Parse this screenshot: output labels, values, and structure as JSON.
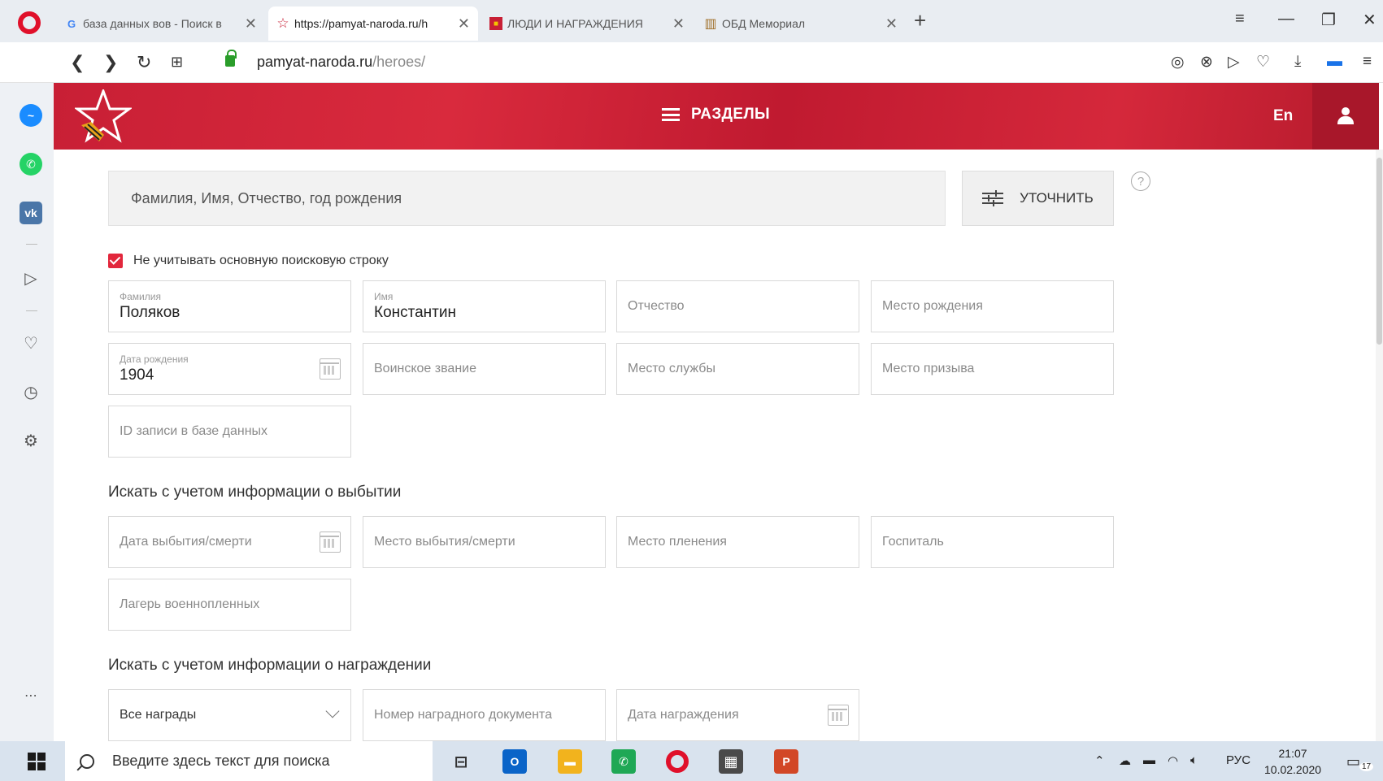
{
  "browser": {
    "tabs": [
      {
        "favicon": "G",
        "title": "база данных вов - Поиск в",
        "active": false
      },
      {
        "favicon": "☆",
        "title": "https://pamyat-naroda.ru/h",
        "active": true
      },
      {
        "favicon": "■",
        "title": "ЛЮДИ И НАГРАЖДЕНИЯ",
        "active": false
      },
      {
        "favicon": "▥",
        "title": "ОБД Мемориал",
        "active": false
      }
    ],
    "url_host": "pamyat-naroda.ru",
    "url_path": "/heroes/"
  },
  "header": {
    "sections_label": "РАЗДЕЛЫ",
    "lang": "En"
  },
  "search": {
    "placeholder": "Фамилия, Имя, Отчество, год рождения",
    "refine_label": "УТОЧНИТЬ",
    "help": "?",
    "ignore_main_label": "Не учитывать основную поисковую строку",
    "ignore_main_checked": true
  },
  "fields": {
    "surname": {
      "label": "Фамилия",
      "value": "Поляков"
    },
    "name": {
      "label": "Имя",
      "value": "Константин"
    },
    "patronymic": {
      "placeholder": "Отчество"
    },
    "birthplace": {
      "placeholder": "Место рождения"
    },
    "birthdate": {
      "label": "Дата рождения",
      "value": "1904"
    },
    "rank": {
      "placeholder": "Воинское звание"
    },
    "service_place": {
      "placeholder": "Место службы"
    },
    "draft_place": {
      "placeholder": "Место призыва"
    },
    "record_id": {
      "placeholder": "ID записи в базе данных"
    }
  },
  "departure": {
    "title": "Искать с учетом информации о выбытии",
    "death_date": "Дата выбытия/смерти",
    "death_place": "Место выбытия/смерти",
    "capture_place": "Место пленения",
    "hospital": "Госпиталь",
    "pow_camp": "Лагерь военнопленных"
  },
  "awards": {
    "title": "Искать с учетом информации о награждении",
    "award_select": "Все награды",
    "doc_number": "Номер наградного документа",
    "award_date": "Дата награждения"
  },
  "taskbar": {
    "search_placeholder": "Введите здесь текст для поиска",
    "lang": "РУС",
    "time": "21:07",
    "date": "10.02.2020",
    "notifications": "17"
  },
  "colors": {
    "brand_red": "#d0223a",
    "checkbox_red": "#e2273c"
  }
}
